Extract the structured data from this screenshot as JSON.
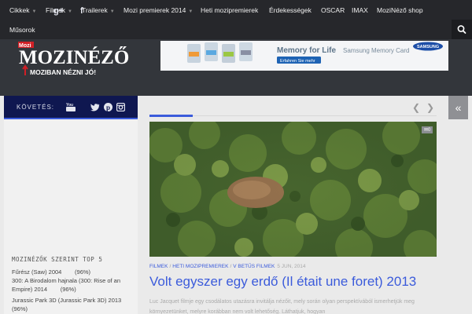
{
  "nav": {
    "items": [
      {
        "label": "Cikkek",
        "dropdown": true
      },
      {
        "label": "Filmek",
        "dropdown": true
      },
      {
        "label": "Trailerek",
        "dropdown": true
      },
      {
        "label": "Mozi premierek 2014",
        "dropdown": true
      },
      {
        "label": "Heti mozipremierek",
        "dropdown": false
      },
      {
        "label": "Érdekességek",
        "dropdown": false
      },
      {
        "label": "OSCAR",
        "dropdown": false
      },
      {
        "label": "IMAX",
        "dropdown": false
      },
      {
        "label": "MoziNéző shop",
        "dropdown": false
      },
      {
        "label": "Műsorok",
        "dropdown": false
      }
    ],
    "search_icon": "search-icon"
  },
  "logo": {
    "badge": "Mozi",
    "name": "MOZINÉZŐ",
    "tagline": "MOZIBAN NÉZNI JÓ!"
  },
  "banner": {
    "headline": "Memory for Life",
    "product": "Samsung Memory Card",
    "cta": "Erfahren Sie mehr",
    "brand": "SAMSUNG"
  },
  "follow": {
    "label": "KÖVETÉS:",
    "icons": [
      "google-plus-icon",
      "youtube-icon",
      "facebook-icon",
      "twitter-icon",
      "pinterest-icon",
      "instagram-icon"
    ]
  },
  "sidebar": {
    "top5_heading": "MOZINÉZŐK SZERINT TOP 5",
    "items": [
      "Fűrész (Saw) 2004        (96%)",
      "300: A Birodalom hajnala (300: Rise of an Empire) 2014        (96%)",
      "Jurassic Park 3D (Jurassic Park 3D) 2013    (96%)"
    ]
  },
  "post": {
    "comment_count": "0",
    "categories": [
      "FILMEK",
      "HETI MOZIPREMIEREK",
      "V BETŰS FILMEK"
    ],
    "date": "5 JUN, 2014",
    "title": "Volt egyszer egy erdő (Il était une foret) 2013",
    "excerpt": "Luc Jacquet filmje egy csodálatos utazásra invitálja nézőit, mely során olyan perspektívából ismerhetjük meg környezetünket, melyre korábban nem volt lehetőség. Láthatjuk, hogyan"
  },
  "colors": {
    "nav_bg": "#26272b",
    "header_bg": "#33363b",
    "accent": "#3b5bdb",
    "follow_bg": "#0f1750",
    "logo_red": "#d11f26"
  }
}
